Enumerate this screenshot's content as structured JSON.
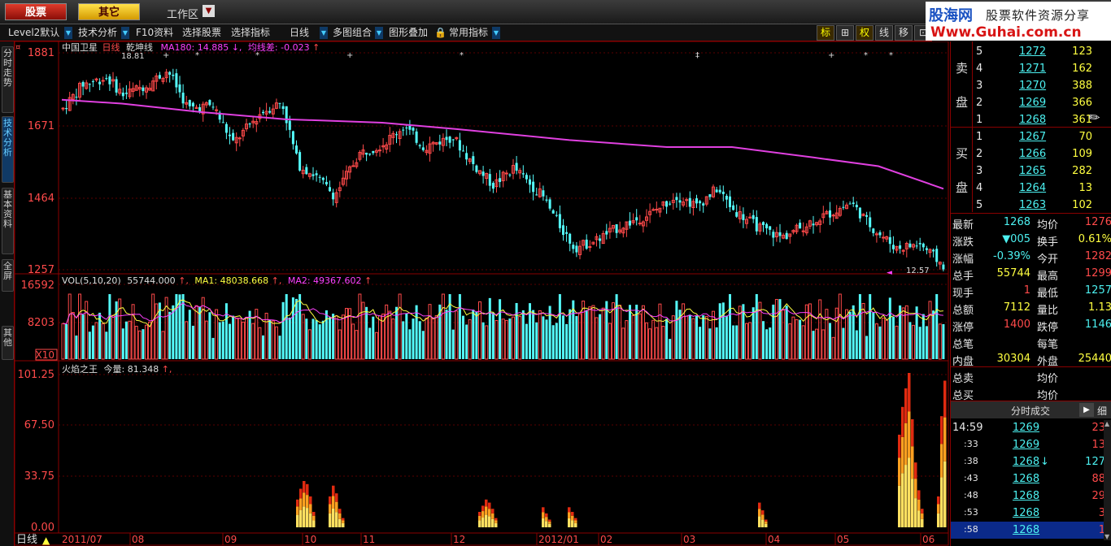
{
  "topbar": {
    "stock_btn": "股票",
    "other_btn": "其它",
    "workspace": "工作区",
    "logo_line1": "股海网",
    "logo_line2": "股票软件资源分享",
    "logo_line3": "Www.Guhai.com.cn"
  },
  "toolbar": {
    "items": [
      "Level2默认",
      "技术分析",
      "F10资料",
      "选择股票",
      "选择指标",
      "日线",
      "多图组合",
      "图形叠加",
      "常用指标"
    ],
    "right_buttons": [
      "标",
      "⊞",
      "权",
      "线",
      "移",
      "⊡"
    ]
  },
  "sidetabs": [
    "分时走势",
    "技术分析",
    "基本资料",
    "全屏",
    "其他"
  ],
  "main_chart": {
    "stock_name": "中国卫星",
    "period": "日线",
    "indicator": "乾坤线",
    "ma_label": "MA180: 14.885",
    "avg_diff": "均线差: -0.023",
    "high_mark": "18.81",
    "low_mark": "12.57",
    "y_ticks": [
      "1881",
      "1671",
      "1464",
      "1257"
    ]
  },
  "vol_chart": {
    "title": "VOL(5,10,20)",
    "vol": "55744.000",
    "ma1": "MA1: 48038.668",
    "ma2": "MA2: 49367.602",
    "y_ticks": [
      "16592",
      "8203",
      "X10"
    ]
  },
  "flame_chart": {
    "title": "火焰之王",
    "value": "今量: 81.348",
    "y_ticks": [
      "101.25",
      "67.50",
      "33.75",
      "0.00"
    ]
  },
  "x_axis": {
    "period_label": "日线",
    "labels": [
      "2011/07",
      "08",
      "09",
      "10",
      "11",
      "12",
      "2012/01",
      "02",
      "03",
      "04",
      "05",
      "06"
    ]
  },
  "order_book": {
    "sell_label_1": "卖",
    "sell_label_2": "盘",
    "buy_label_1": "买",
    "buy_label_2": "盘",
    "sell": [
      {
        "level": "5",
        "price": "1272",
        "vol": "123"
      },
      {
        "level": "4",
        "price": "1271",
        "vol": "162"
      },
      {
        "level": "3",
        "price": "1270",
        "vol": "388"
      },
      {
        "level": "2",
        "price": "1269",
        "vol": "366"
      },
      {
        "level": "1",
        "price": "1268",
        "vol": "361"
      }
    ],
    "buy": [
      {
        "level": "1",
        "price": "1267",
        "vol": "70"
      },
      {
        "level": "2",
        "price": "1266",
        "vol": "109"
      },
      {
        "level": "3",
        "price": "1265",
        "vol": "282"
      },
      {
        "level": "4",
        "level_b": "",
        "price": "1264",
        "vol": "13"
      },
      {
        "level": "5",
        "price": "1263",
        "vol": "102"
      }
    ]
  },
  "quote": [
    {
      "l1": "最新",
      "v1": "1268",
      "l2": "均价",
      "v2": "1276"
    },
    {
      "l1": "涨跌",
      "v1": "▼005",
      "l2": "换手",
      "v2": "0.61%"
    },
    {
      "l1": "涨幅",
      "v1": "-0.39%",
      "l2": "今开",
      "v2": "1282"
    },
    {
      "l1": "总手",
      "v1": "55744",
      "l2": "最高",
      "v2": "1299"
    },
    {
      "l1": "现手",
      "v1": "1",
      "l2": "最低",
      "v2": "1257"
    },
    {
      "l1": "总额",
      "v1": "7112",
      "l2": "量比",
      "v2": "1.13"
    },
    {
      "l1": "涨停",
      "v1": "1400",
      "l2": "跌停",
      "v2": "1146"
    },
    {
      "l1": "总笔",
      "v1": "",
      "l2": "每笔",
      "v2": ""
    },
    {
      "l1": "内盘",
      "v1": "30304",
      "l2": "外盘",
      "v2": "25440"
    }
  ],
  "totals": [
    {
      "l1": "总卖",
      "l2": "均价"
    },
    {
      "l1": "总买",
      "l2": "均价"
    }
  ],
  "ticks_panel": {
    "title": "分时成交",
    "detail": "细",
    "rows": [
      {
        "time": "14:59",
        "price": "1269",
        "arrow": "",
        "vol": "23"
      },
      {
        "time": ":33",
        "price": "1269",
        "arrow": "",
        "vol": "13"
      },
      {
        "time": ":38",
        "price": "1268",
        "arrow": "↓",
        "vol": "127"
      },
      {
        "time": ":43",
        "price": "1268",
        "arrow": "",
        "vol": "88"
      },
      {
        "time": ":48",
        "price": "1268",
        "arrow": "",
        "vol": "29"
      },
      {
        "time": ":53",
        "price": "1268",
        "arrow": "",
        "vol": "3"
      },
      {
        "time": ":58",
        "price": "1268",
        "arrow": "",
        "vol": "1"
      }
    ]
  }
}
